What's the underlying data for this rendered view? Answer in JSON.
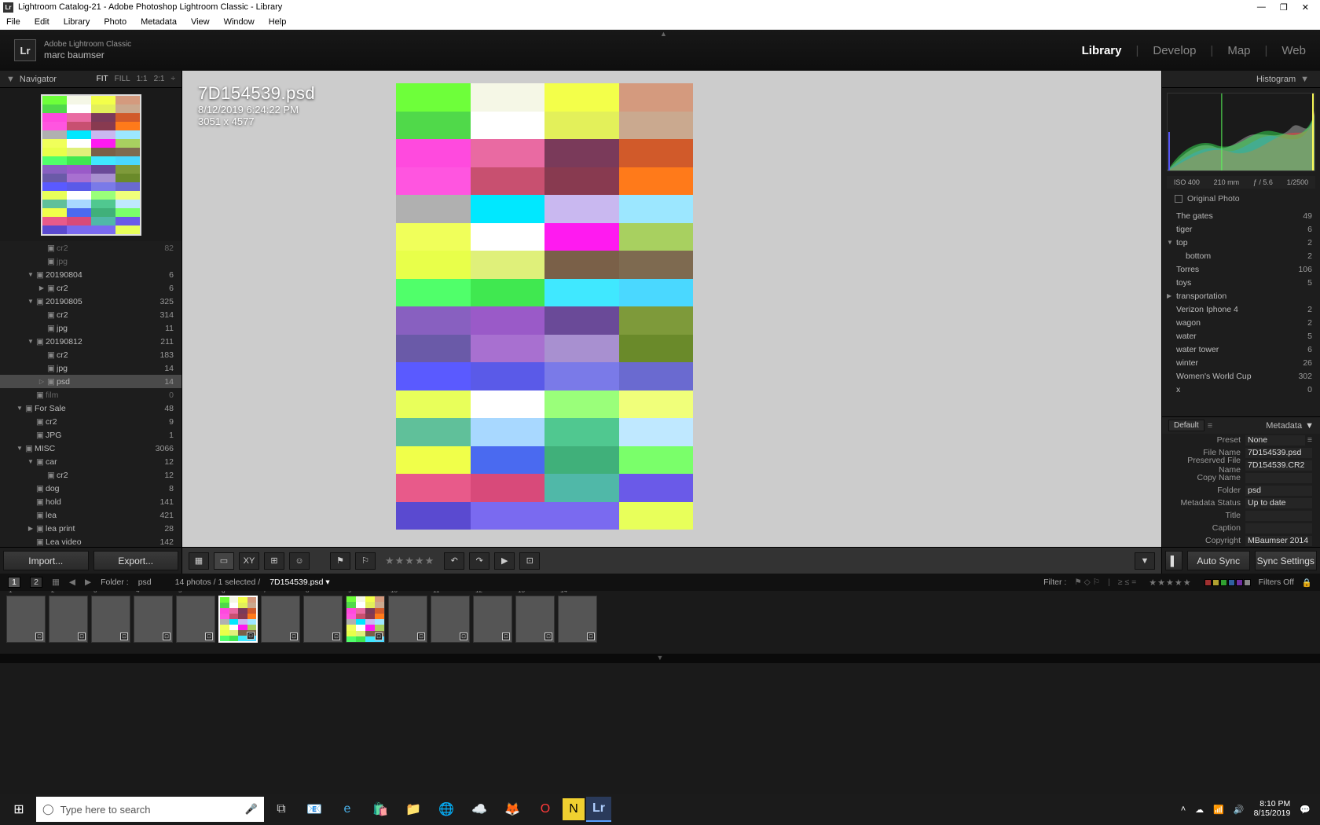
{
  "title": "Lightroom Catalog-21 - Adobe Photoshop Lightroom Classic - Library",
  "menu": [
    "File",
    "Edit",
    "Library",
    "Photo",
    "Metadata",
    "View",
    "Window",
    "Help"
  ],
  "brand": {
    "line1": "Adobe Lightroom Classic",
    "line2": "marc baumser"
  },
  "modules": [
    "Library",
    "Develop",
    "Map",
    "Web"
  ],
  "activeModule": "Library",
  "navigator": {
    "title": "Navigator",
    "modes": [
      "FIT",
      "FILL",
      "1:1",
      "2:1"
    ],
    "activeMode": "FIT"
  },
  "folders": [
    {
      "indent": 2,
      "name": "cr2",
      "count": "82",
      "dim": true
    },
    {
      "indent": 2,
      "name": "jpg",
      "count": "",
      "dim": true
    },
    {
      "indent": 1,
      "exp": "▼",
      "name": "20190804",
      "count": "6"
    },
    {
      "indent": 2,
      "exp": "▶",
      "name": "cr2",
      "count": "6"
    },
    {
      "indent": 1,
      "exp": "▼",
      "name": "20190805",
      "count": "325"
    },
    {
      "indent": 2,
      "name": "cr2",
      "count": "314"
    },
    {
      "indent": 2,
      "name": "jpg",
      "count": "11"
    },
    {
      "indent": 1,
      "exp": "▼",
      "name": "20190812",
      "count": "211"
    },
    {
      "indent": 2,
      "name": "cr2",
      "count": "183"
    },
    {
      "indent": 2,
      "name": "jpg",
      "count": "14"
    },
    {
      "indent": 2,
      "exp": "▷",
      "name": "psd",
      "count": "14",
      "sel": true
    },
    {
      "indent": 1,
      "name": "film",
      "count": "0",
      "dim": true
    },
    {
      "indent": 0,
      "exp": "▼",
      "name": "For Sale",
      "count": "48"
    },
    {
      "indent": 1,
      "name": "cr2",
      "count": "9"
    },
    {
      "indent": 1,
      "name": "JPG",
      "count": "1"
    },
    {
      "indent": 0,
      "exp": "▼",
      "name": "MISC",
      "count": "3066"
    },
    {
      "indent": 1,
      "exp": "▼",
      "name": "car",
      "count": "12"
    },
    {
      "indent": 2,
      "name": "cr2",
      "count": "12"
    },
    {
      "indent": 1,
      "name": "dog",
      "count": "8"
    },
    {
      "indent": 1,
      "name": "hold",
      "count": "141"
    },
    {
      "indent": 1,
      "name": "lea",
      "count": "421"
    },
    {
      "indent": 1,
      "exp": "▶",
      "name": "lea print",
      "count": "28"
    },
    {
      "indent": 1,
      "name": "Lea video",
      "count": "142"
    }
  ],
  "footerBtns": [
    "Import...",
    "Export..."
  ],
  "loupe": {
    "filename": "7D154539.psd",
    "datetime": "8/12/2019 6:24:22 PM",
    "dimensions": "3051 x 4577"
  },
  "rightTop": {
    "title": "Histogram",
    "iso": "ISO 400",
    "fl": "210 mm",
    "f": "ƒ / 5.6",
    "ss": "1/2500",
    "orig": "Original Photo"
  },
  "keywords": [
    {
      "name": "The gates",
      "count": "49"
    },
    {
      "name": "tiger",
      "count": "6"
    },
    {
      "exp": "▼",
      "name": "top",
      "count": "2"
    },
    {
      "indent": 1,
      "name": "bottom",
      "count": "2"
    },
    {
      "name": "Torres",
      "count": "106"
    },
    {
      "name": "toys",
      "count": "5"
    },
    {
      "exp": "▶",
      "name": "transportation",
      "count": ""
    },
    {
      "name": "Verizon Iphone 4",
      "count": "2"
    },
    {
      "name": "wagon",
      "count": "2"
    },
    {
      "name": "water",
      "count": "5"
    },
    {
      "name": "water tower",
      "count": "6"
    },
    {
      "name": "winter",
      "count": "26"
    },
    {
      "name": "Women's World Cup",
      "count": "302"
    },
    {
      "name": "x",
      "count": "0"
    }
  ],
  "metaPanel": {
    "mode": "Default",
    "title": "Metadata",
    "preset": "None",
    "rows": [
      {
        "lbl": "File Name",
        "val": "7D154539.psd"
      },
      {
        "lbl": "Preserved File Name",
        "val": "7D154539.CR2"
      },
      {
        "lbl": "Copy Name",
        "val": ""
      },
      {
        "lbl": "Folder",
        "val": "psd"
      },
      {
        "lbl": "Metadata Status",
        "val": "Up to date"
      },
      {
        "lbl": "Title",
        "val": ""
      },
      {
        "lbl": "Caption",
        "val": ""
      },
      {
        "lbl": "Copyright",
        "val": "MBaumser 2014"
      }
    ]
  },
  "filmbar": {
    "pages": [
      "1",
      "2"
    ],
    "folderLabel": "Folder :",
    "folder": "psd",
    "status": "14 photos / 1 selected /",
    "current": "7D154539.psd",
    "filterLabel": "Filter :",
    "filtersOff": "Filters Off"
  },
  "syncBtns": [
    "Auto Sync",
    "Sync Settings"
  ],
  "taskbar": {
    "search": "Type here to search",
    "time": "8:10 PM",
    "date": "8/15/2019"
  },
  "mosaicColors": [
    "#6eff3a",
    "#f5f7e6",
    "#f3ff4a",
    "#d49a7e",
    "#50d94a",
    "#fff",
    "#e3f05a",
    "#caa98f",
    "#ff4ade",
    "#e96aa2",
    "#7a3a5a",
    "#d15a2a",
    "#ff55e0",
    "#c85070",
    "#883a50",
    "#ff7a1a",
    "#b0b0b0",
    "#00e8ff",
    "#c9b8f0",
    "#9ce7ff",
    "#f0ff5a",
    "#fff",
    "#ff1af0",
    "#a8d060",
    "#e8ff4a",
    "#dff07a",
    "#7a6048",
    "#7e6a50",
    "#50ff6a",
    "#40e850",
    "#40e8ff",
    "#4ad8ff",
    "#8860c0",
    "#9a5ac8",
    "#6a4a98",
    "#7e9a3a",
    "#6a5aa8",
    "#a870d0",
    "#a890d0",
    "#6a8a2a",
    "#5a5aff",
    "#5a5ae8",
    "#7a7ae8",
    "#6a6ad0",
    "#e8ff5a",
    "#fff",
    "#9aff7a",
    "#f0ff7a",
    "#60c09a",
    "#a8d8ff",
    "#50c890",
    "#bfe8ff",
    "#f0ff4a",
    "#4a6af0",
    "#40b07a",
    "#7aff6a",
    "#e85a8a",
    "#d84a7a",
    "#50b8a8",
    "#6a5ae8",
    "#5a4ad0",
    "#7a6af0",
    "#7a6af0",
    "#e8ff5a"
  ]
}
